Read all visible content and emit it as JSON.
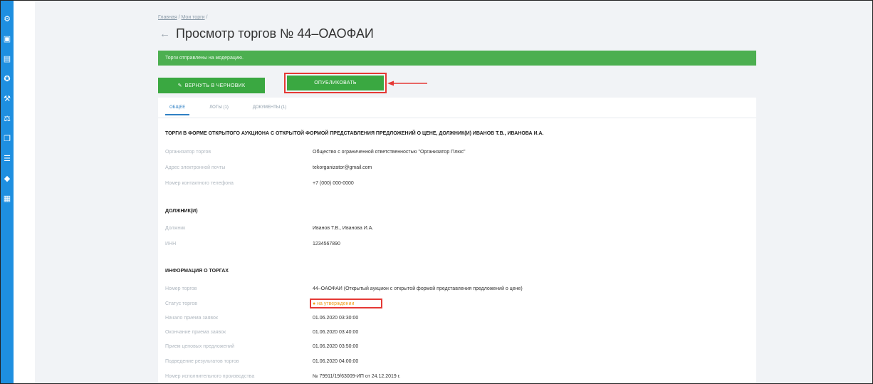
{
  "sidebar": {
    "icons": [
      "gear-icon",
      "image-icon",
      "document-icon",
      "award-icon",
      "auction-icon",
      "hammer-icon",
      "file-icon",
      "list-icon",
      "bag-icon",
      "report-icon"
    ]
  },
  "breadcrumb": {
    "item1": "Главная",
    "sep": "/",
    "item2": "Мои торги"
  },
  "page": {
    "back_icon": "←",
    "title": "Просмотр торгов № 44–ОАОФАИ"
  },
  "alert": {
    "text": "Торги отправлены на модерацию."
  },
  "actions": {
    "draft_label": "ВЕРНУТЬ В ЧЕРНОВИК",
    "draft_icon": "✎",
    "publish_label": "ОПУБЛИКОВАТЬ"
  },
  "tabs": [
    {
      "label": "ОБЩЕЕ"
    },
    {
      "label": "ЛОТЫ (1)"
    },
    {
      "label": "ДОКУМЕНТЫ (1)"
    }
  ],
  "sections": {
    "main_title": "ТОРГИ В ФОРМЕ ОТКРЫТОГО АУКЦИОНА С ОТКРЫТОЙ ФОРМОЙ ПРЕДСТАВЛЕНИЯ ПРЕДЛОЖЕНИЙ О ЦЕНЕ, ДОЛЖНИК(И) ИВАНОВ Т.В., ИВАНОВА И.А.",
    "debtors_title": "ДОЛЖНИК(И)",
    "info_title": "ИНФОРМАЦИЯ О ТОРГАХ"
  },
  "organizer": [
    {
      "label": "Организатор торгов",
      "value": "Общество с ограниченной ответственностью \"Организатор Плюс\""
    },
    {
      "label": "Адрес электронной почты",
      "value": "tekorganizator@gmail.com"
    },
    {
      "label": "Номер контактного телефона",
      "value": "+7 (000) 000-0000"
    }
  ],
  "debtors": [
    {
      "label": "Должник",
      "value": "Иванов Т.В., Иванова И.А."
    },
    {
      "label": "ИНН",
      "value": "1234567890"
    }
  ],
  "info": [
    {
      "label": "Номер торгов",
      "value": "44–ОАОФАИ (Открытый аукцион с открытой формой представления предложений о цене)"
    },
    {
      "label": "Статус торгов",
      "value": "● на утверждении"
    },
    {
      "label": "Начало приема заявок",
      "value": "01.06.2020 03:30:00"
    },
    {
      "label": "Окончание приема заявок",
      "value": "01.06.2020 03:40:00"
    },
    {
      "label": "Прием ценовых предложений",
      "value": "01.06.2020 03:50:00"
    },
    {
      "label": "Подведение результатов торгов",
      "value": "01.06.2020 04:00:00"
    },
    {
      "label": "Номер исполнительного производства",
      "value": "№ 79911/19/63009-ИП от 24.12.2019 г."
    }
  ],
  "colors": {
    "accent_green": "#3aa841",
    "sidebar_blue": "#1e8fe0",
    "highlight_red": "#e53935",
    "status_orange": "#f0a020"
  }
}
